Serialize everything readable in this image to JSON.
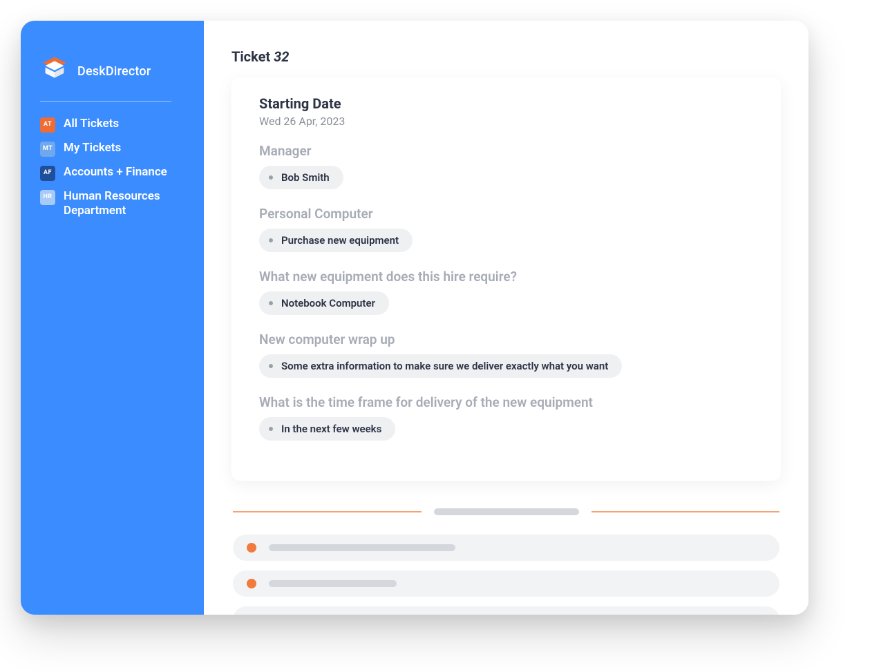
{
  "brand": {
    "name": "DeskDirector"
  },
  "sidebar": {
    "items": [
      {
        "abbr": "AT",
        "label": "All Tickets",
        "bg": "#ef6c35",
        "fg": "#ffffff"
      },
      {
        "abbr": "MT",
        "label": "My Tickets",
        "bg": "#6fa8ee",
        "fg": "#ffffff"
      },
      {
        "abbr": "AF",
        "label": "Accounts + Finance",
        "bg": "#1f4f9a",
        "fg": "#ffffff"
      },
      {
        "abbr": "HR",
        "label": "Human Resources Department",
        "bg": "#a7caf7",
        "fg": "#ffffff"
      }
    ]
  },
  "ticket": {
    "title_prefix": "Ticket",
    "number": "32",
    "card_heading": "Starting Date",
    "date": "Wed 26 Apr, 2023",
    "fields": [
      {
        "label": "Manager",
        "value": "Bob Smith"
      },
      {
        "label": "Personal Computer",
        "value": "Purchase new equipment"
      },
      {
        "label": "What new equipment does this hire require?",
        "value": "Notebook Computer"
      },
      {
        "label": "New computer wrap up",
        "value": "Some extra information to make sure we deliver exactly what you want"
      },
      {
        "label": "What is the time frame for delivery of the new equipment",
        "value": "In the next few weeks"
      }
    ]
  },
  "placeholders": {
    "row_bar_widths": [
      270,
      185,
      200
    ]
  },
  "colors": {
    "sidebar": "#3b8cff",
    "accent_orange": "#f07b3c",
    "text_dark": "#2c3344",
    "text_muted": "#a6abb5"
  }
}
